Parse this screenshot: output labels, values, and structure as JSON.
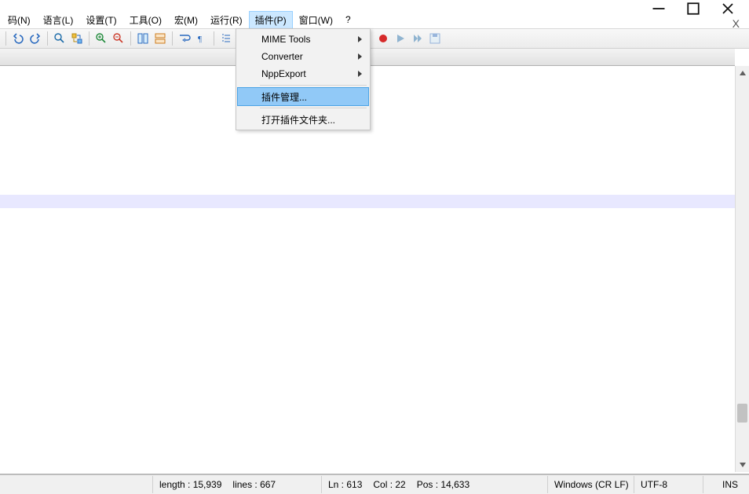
{
  "window_controls": {
    "minimize": "minimize",
    "restore": "restore",
    "close": "close"
  },
  "close_doc_label": "X",
  "menubar": [
    {
      "key": "encoding",
      "label": "码(N)"
    },
    {
      "key": "language",
      "label": "语言(L)"
    },
    {
      "key": "settings",
      "label": "设置(T)"
    },
    {
      "key": "tools",
      "label": "工具(O)"
    },
    {
      "key": "macro",
      "label": "宏(M)"
    },
    {
      "key": "run",
      "label": "运行(R)"
    },
    {
      "key": "plugins",
      "label": "插件(P)",
      "open": true
    },
    {
      "key": "window",
      "label": "窗口(W)"
    },
    {
      "key": "help",
      "label": "?"
    }
  ],
  "plugins_menu": {
    "items": [
      {
        "label": "MIME Tools",
        "submenu": true
      },
      {
        "label": "Converter",
        "submenu": true
      },
      {
        "label": "NppExport",
        "submenu": true
      }
    ],
    "highlighted": {
      "label": "插件管理..."
    },
    "open_folder": {
      "label": "打开插件文件夹..."
    }
  },
  "statusbar": {
    "length_label": "length : 15,939",
    "lines_label": "lines : 667",
    "ln_label": "Ln : 613",
    "col_label": "Col : 22",
    "pos_label": "Pos : 14,633",
    "eol_label": "Windows (CR LF)",
    "encoding_label": "UTF-8",
    "ins_label": "INS"
  }
}
